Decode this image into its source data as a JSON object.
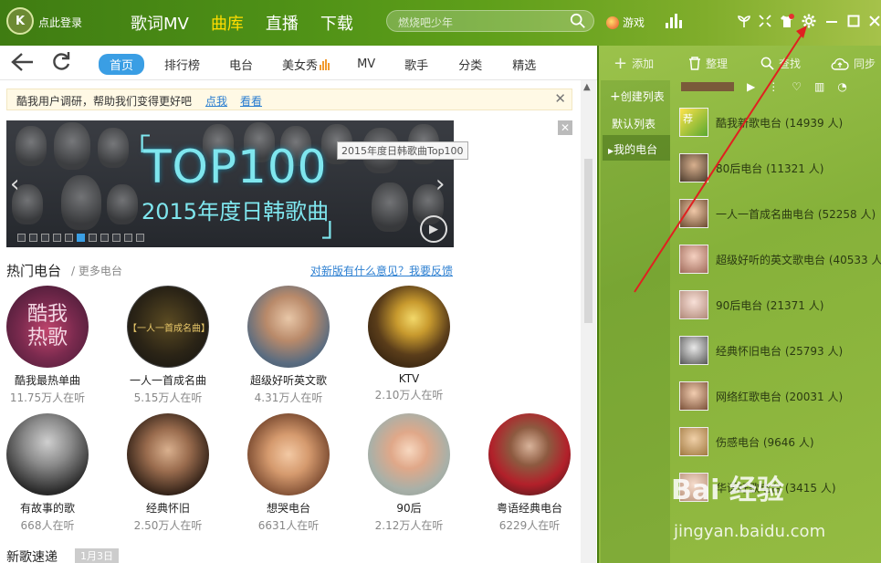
{
  "topbar": {
    "login_text": "点此登录",
    "nav": [
      "歌词MV",
      "曲库",
      "直播",
      "下载"
    ],
    "active_nav": "曲库",
    "search_placeholder": "燃烧吧少年",
    "game_label": "游戏"
  },
  "subnav": {
    "tabs": [
      "首页",
      "排行榜",
      "电台",
      "美女秀",
      "MV",
      "歌手",
      "分类",
      "精选"
    ],
    "active": "首页"
  },
  "survey": {
    "text": "酷我用户调研，帮助我们变得更好吧",
    "link1": "点我",
    "link2": "看看"
  },
  "banner": {
    "big_text": "TOP100",
    "sub_text": "2015年度日韩歌曲",
    "tooltip": "2015年度日韩歌曲Top100",
    "dot_count": 11,
    "active_dot": 5
  },
  "radio_section": {
    "title": "热门电台",
    "more": "/ 更多电台",
    "feedback": "对新版有什么意见？我要反馈",
    "stations": [
      {
        "name": "酷我最热单曲",
        "count": "11.75万人在听"
      },
      {
        "name": "一人一首成名曲",
        "count": "5.15万人在听"
      },
      {
        "name": "超级好听英文歌",
        "count": "4.31万人在听"
      },
      {
        "name": "KTV",
        "count": "2.10万人在听"
      },
      {
        "name": "有故事的歌",
        "count": "668人在听"
      },
      {
        "name": "经典怀旧",
        "count": "2.50万人在听"
      },
      {
        "name": "想哭电台",
        "count": "6631人在听"
      },
      {
        "name": "90后",
        "count": "2.12万人在听"
      },
      {
        "name": "粤语经典电台",
        "count": "6229人在听"
      }
    ],
    "new_songs": "新歌速递",
    "date_badge": "1月3日"
  },
  "right_panel": {
    "toolbar": [
      "添加",
      "整理",
      "查找",
      "同步"
    ],
    "left_items": [
      "创建列表",
      "默认列表",
      "我的电台"
    ],
    "selected_left": "我的电台",
    "radios": [
      "酷我新歌电台 (14939 人)",
      "80后电台 (11321 人)",
      "一人一首成名曲电台 (52258 人)",
      "超级好听的英文歌电台 (40533 人",
      "90后电台 (21371 人)",
      "经典怀旧电台 (25793 人)",
      "网络红歌电台 (20031 人)",
      "伤感电台 (9646 人)",
      "华语好歌电台 (3415 人)"
    ],
    "thumb_badge": "荐"
  },
  "watermark": {
    "text": "Bai 经验",
    "url": "jingyan.baidu.com"
  },
  "colors": {
    "accent_green": "#4d8f16",
    "active_yellow": "#ffdd00",
    "tab_blue": "#3a9ee4",
    "arrow_red": "#e02020"
  }
}
